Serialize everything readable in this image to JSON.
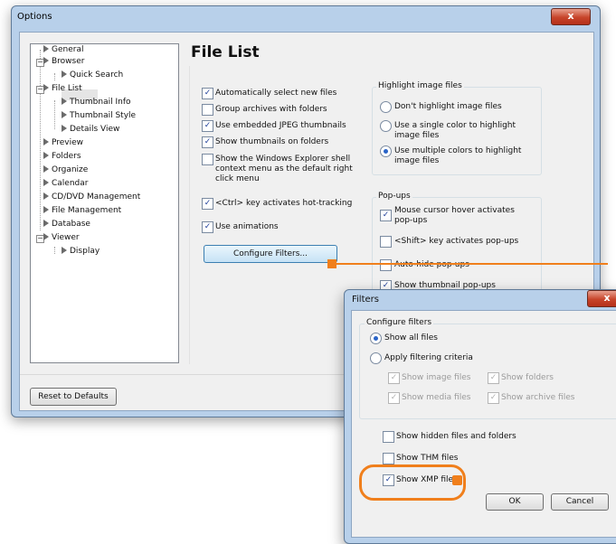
{
  "options": {
    "title": "Options",
    "close": "x",
    "heading": "File List",
    "tree": [
      {
        "label": "General"
      },
      {
        "label": "Browser"
      },
      {
        "label": "Quick Search"
      },
      {
        "label": "File List"
      },
      {
        "label": "Thumbnail Info"
      },
      {
        "label": "Thumbnail Style"
      },
      {
        "label": "Details View"
      },
      {
        "label": "Preview"
      },
      {
        "label": "Folders"
      },
      {
        "label": "Organize"
      },
      {
        "label": "Calendar"
      },
      {
        "label": "CD/DVD Management"
      },
      {
        "label": "File Management"
      },
      {
        "label": "Database"
      },
      {
        "label": "Viewer"
      },
      {
        "label": "Display"
      }
    ],
    "checks": [
      {
        "label": "Automatically select new files",
        "checked": true
      },
      {
        "label": "Group archives with folders",
        "checked": false
      },
      {
        "label": "Use embedded JPEG thumbnails",
        "checked": true
      },
      {
        "label": "Show thumbnails on folders",
        "checked": true
      },
      {
        "label": "Show the Windows Explorer shell context menu as the default right click menu",
        "checked": false
      },
      {
        "label": "<Ctrl> key activates hot-tracking",
        "checked": true
      },
      {
        "label": "Use animations",
        "checked": true
      }
    ],
    "configure_filters": "Configure Filters...",
    "highlight": {
      "title": "Highlight image files",
      "options": [
        {
          "label": "Don't highlight image files",
          "selected": false
        },
        {
          "label": "Use a single color to highlight image files",
          "selected": false
        },
        {
          "label": "Use multiple colors to highlight image files",
          "selected": true
        }
      ]
    },
    "popups": {
      "title": "Pop-ups",
      "checks": [
        {
          "label": "Mouse cursor hover activates pop-ups",
          "checked": true
        },
        {
          "label": "<Shift> key activates pop-ups",
          "checked": false
        },
        {
          "label": "Auto-hide pop-ups",
          "checked": false
        },
        {
          "label": "Show thumbnail pop-ups",
          "checked": true
        }
      ]
    },
    "reset": "Reset to Defaults"
  },
  "filters": {
    "title": "Filters",
    "close": "x",
    "group_title": "Configure filters",
    "show_all": "Show all files",
    "apply_criteria": "Apply filtering criteria",
    "sub": [
      {
        "label": "Show image files",
        "checked": true
      },
      {
        "label": "Show folders",
        "checked": true
      },
      {
        "label": "Show media files",
        "checked": true
      },
      {
        "label": "Show archive files",
        "checked": true
      }
    ],
    "hidden": {
      "label": "Show hidden files and folders",
      "checked": false
    },
    "thm": {
      "label": "Show THM files",
      "checked": false
    },
    "xmp": {
      "label": "Show XMP files",
      "checked": true
    },
    "ok": "OK",
    "cancel": "Cancel"
  },
  "colors": {
    "accent": "#f07f1c",
    "title_bar": "#b8d0ea",
    "close": "#c7442a"
  }
}
